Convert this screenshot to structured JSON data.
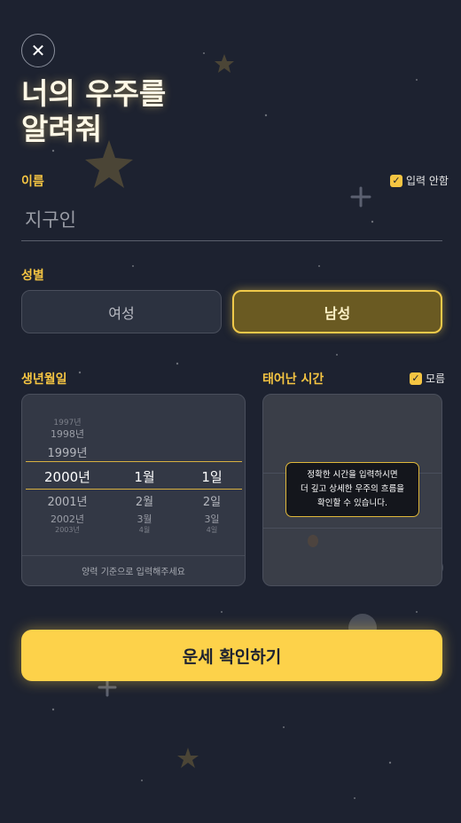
{
  "header": {
    "close_icon": "close-icon",
    "title": "너의 우주를\n알려줘"
  },
  "name": {
    "label": "이름",
    "skip_label": "입력 안함",
    "skip_checked": true,
    "value": "지구인"
  },
  "gender": {
    "label": "성별",
    "options": [
      "여성",
      "남성"
    ],
    "selected": "남성"
  },
  "birthdate": {
    "label": "생년월일",
    "years": [
      "1997년",
      "1998년",
      "1999년",
      "2000년",
      "2001년",
      "2002년",
      "2003년"
    ],
    "months": [
      "1월",
      "2월",
      "3월",
      "4월"
    ],
    "days": [
      "1일",
      "2일",
      "3일",
      "4일"
    ],
    "selected_year": "2000년",
    "selected_month": "1월",
    "selected_day": "1일",
    "hint": "양력 기준으로 입력해주세요"
  },
  "birthtime": {
    "label": "태어난 시간",
    "unknown_label": "모름",
    "unknown_checked": true,
    "tooltip": "정확한 시간을 입력하시면\n더 깊고 상세한 우주의 흐름을\n확인할 수 있습니다."
  },
  "cta": {
    "label": "운세 확인하기"
  },
  "colors": {
    "background": "#1d2230",
    "accent": "#fdd24a",
    "label": "#f5c542"
  }
}
